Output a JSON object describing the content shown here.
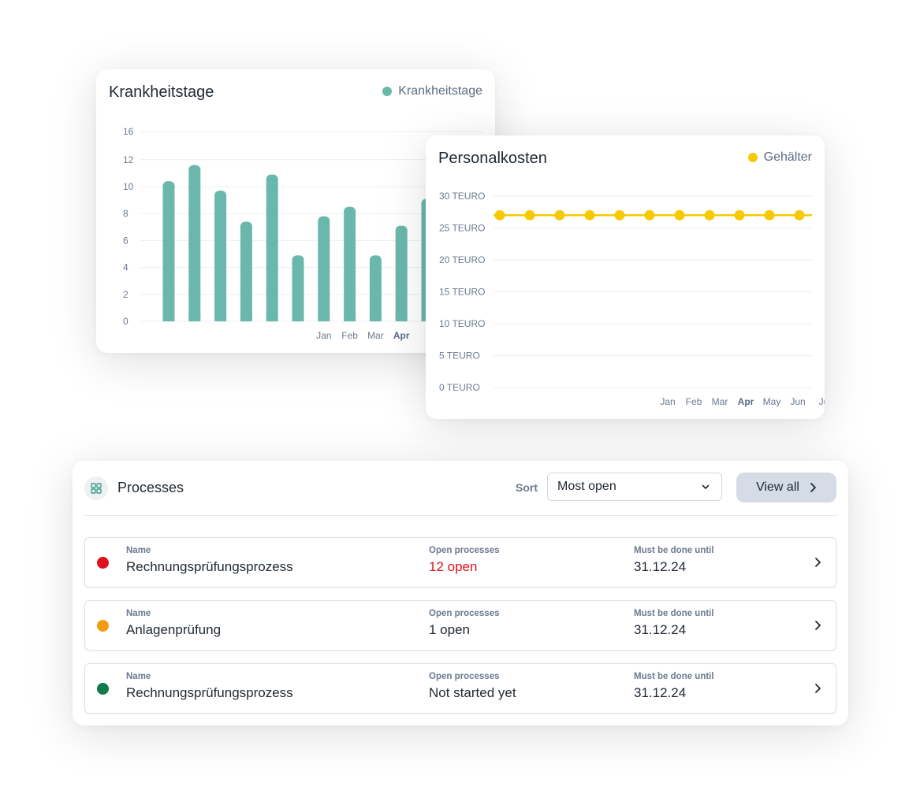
{
  "sick_days_card": {
    "title": "Krankheitstage",
    "legend": "Krankheitstage",
    "chart_data": {
      "type": "bar",
      "title": "Krankheitstage",
      "series": [
        {
          "name": "Krankheitstage",
          "values": [
            10.4,
            11.6,
            9.7,
            7.4,
            10.9,
            4.9,
            7.8,
            8.5,
            4.9,
            7.1,
            9.1
          ]
        }
      ],
      "y_ticks": [
        "0",
        "2",
        "4",
        "6",
        "8",
        "10",
        "12",
        "16"
      ],
      "x_labels": [
        "Jan",
        "Feb",
        "Mar",
        "Apr"
      ],
      "x_label_start_index": 6,
      "highlight_label": "Apr",
      "ylim": [
        0,
        16
      ],
      "grid": true,
      "legend_position": "top-right",
      "color": "#6ab8ab"
    }
  },
  "personnel_cost_card": {
    "title": "Personalkosten",
    "legend": "Gehälter",
    "chart_data": {
      "type": "line",
      "title": "Personalkosten",
      "series": [
        {
          "name": "Gehälter",
          "values": [
            27,
            27,
            27,
            27,
            27,
            27,
            27,
            27,
            27,
            27,
            27
          ]
        }
      ],
      "y_ticks": [
        "0 TEURO",
        "5 TEURO",
        "10 TEURO",
        "15 TEURO",
        "20 TEURO",
        "25 TEURO",
        "30 TEURO"
      ],
      "ylim": [
        0,
        30
      ],
      "x_labels": [
        "Jan",
        "Feb",
        "Mar",
        "Apr",
        "May",
        "Jun",
        "Ju"
      ],
      "highlight_label": "Apr",
      "grid": true,
      "legend_position": "top-right",
      "color": "#f7c900"
    }
  },
  "processes": {
    "title": "Processes",
    "sort_label": "Sort",
    "sort_value": "Most open",
    "view_all_label": "View all",
    "rows": [
      {
        "status_color": "#e0101e",
        "name_label": "Name",
        "name": "Rechnungsprüfungsprozess",
        "open_label": "Open processes",
        "open": "12 open",
        "open_color": "#e0101e",
        "due_label": "Must be done until",
        "due": "31.12.24"
      },
      {
        "status_color": "#f39c12",
        "name_label": "Name",
        "name": "Anlagenprüfung",
        "open_label": "Open processes",
        "open": "1 open",
        "open_color": "#1f2933",
        "due_label": "Must be done until",
        "due": "31.12.24"
      },
      {
        "status_color": "#0f7a4c",
        "name_label": "Name",
        "name": "Rechnungsprüfungsprozess",
        "open_label": "Open processes",
        "open": "Not started yet",
        "open_color": "#1f2933",
        "due_label": "Must be done until",
        "due": "31.12.24"
      }
    ]
  }
}
